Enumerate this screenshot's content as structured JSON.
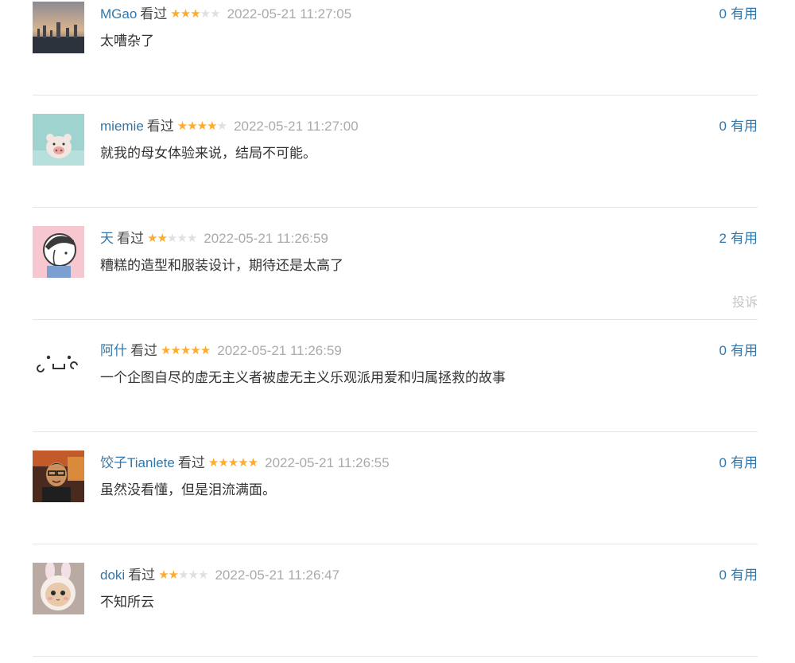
{
  "comments": [
    {
      "user": "MGao",
      "watched": "看过",
      "rating": 3,
      "time": "2022-05-21 11:27:05",
      "text": "太嘈杂了",
      "votes": "0",
      "vote_label": "有用"
    },
    {
      "user": "miemie",
      "watched": "看过",
      "rating": 4,
      "time": "2022-05-21 11:27:00",
      "text": "就我的母女体验来说，结局不可能。",
      "votes": "0",
      "vote_label": "有用"
    },
    {
      "user": "天",
      "watched": "看过",
      "rating": 2,
      "time": "2022-05-21 11:26:59",
      "text": "糟糕的造型和服装设计，期待还是太高了",
      "votes": "2",
      "vote_label": "有用",
      "report_label": "投诉"
    },
    {
      "user": "阿什",
      "watched": "看过",
      "rating": 5,
      "time": "2022-05-21 11:26:59",
      "text": "一个企图自尽的虚无主义者被虚无主义乐观派用爱和归属拯救的故事",
      "votes": "0",
      "vote_label": "有用"
    },
    {
      "user": "饺子Tianlete",
      "watched": "看过",
      "rating": 5,
      "time": "2022-05-21 11:26:55",
      "text": "虽然没看懂，但是泪流满面。",
      "votes": "0",
      "vote_label": "有用"
    },
    {
      "user": "doki",
      "watched": "看过",
      "rating": 2,
      "time": "2022-05-21 11:26:47",
      "text": "不知所云",
      "votes": "0",
      "vote_label": "有用"
    }
  ],
  "colors": {
    "link": "#3377aa",
    "star_on": "#ffac2d",
    "star_off": "#e0e0e0",
    "time": "#aaaaaa"
  }
}
